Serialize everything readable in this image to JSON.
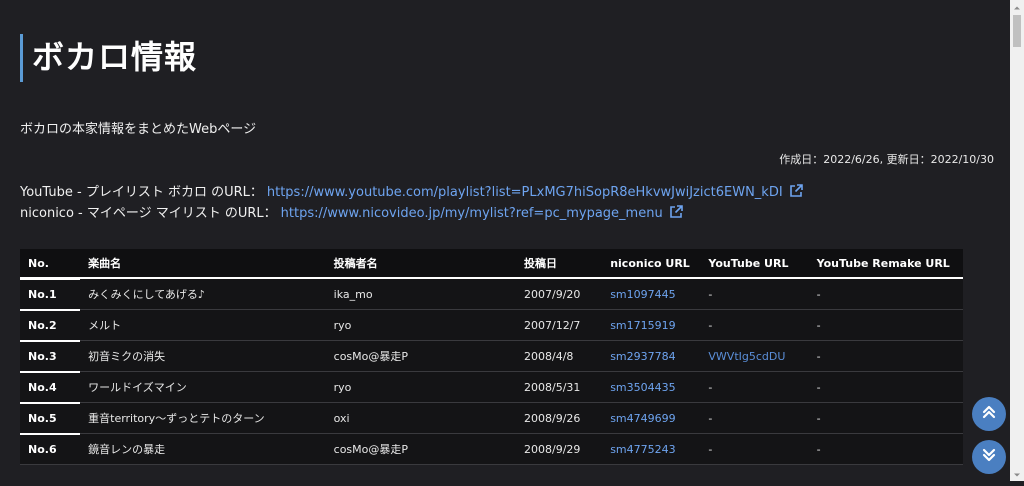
{
  "page": {
    "title": "ボカロ情報",
    "description": "ボカロの本家情報をまとめたWebページ",
    "dates": "作成日：2022/6/26, 更新日：2022/10/30"
  },
  "links": [
    {
      "label": "YouTube - プレイリスト ボカロ のURL：",
      "url": "https://www.youtube.com/playlist?list=PLxMG7hiSopR8eHkvwJwiJzict6EWN_kDI",
      "icon": "external-link-icon"
    },
    {
      "label": "niconico - マイページ マイリスト のURL：",
      "url": "https://www.nicovideo.jp/my/mylist?ref=pc_mypage_menu",
      "icon": "external-link-icon"
    }
  ],
  "table": {
    "headers": [
      "No.",
      "楽曲名",
      "投稿者名",
      "投稿日",
      "niconico URL",
      "YouTube URL",
      "YouTube Remake URL"
    ],
    "rows": [
      {
        "no": "No.1",
        "title": "みくみくにしてあげる♪",
        "author": "ika_mo",
        "date": "2007/9/20",
        "nico": "sm1097445",
        "youtube": "-",
        "remake": "-"
      },
      {
        "no": "No.2",
        "title": "メルト",
        "author": "ryo",
        "date": "2007/12/7",
        "nico": "sm1715919",
        "youtube": "-",
        "remake": "-"
      },
      {
        "no": "No.3",
        "title": "初音ミクの消失",
        "author": "cosMo@暴走P",
        "date": "2008/4/8",
        "nico": "sm2937784",
        "youtube": "VWVtIg5cdDU",
        "remake": "-"
      },
      {
        "no": "No.4",
        "title": "ワールドイズマイン",
        "author": "ryo",
        "date": "2008/5/31",
        "nico": "sm3504435",
        "youtube": "-",
        "remake": "-"
      },
      {
        "no": "No.5",
        "title": "重音territory～ずっとテトのターン",
        "author": "oxi",
        "date": "2008/9/26",
        "nico": "sm4749699",
        "youtube": "-",
        "remake": "-"
      },
      {
        "no": "No.6",
        "title": "鏡音レンの暴走",
        "author": "cosMo@暴走P",
        "date": "2008/9/29",
        "nico": "sm4775243",
        "youtube": "-",
        "remake": "-"
      }
    ]
  },
  "buttons": {
    "scroll_top_icon": "double-chevron-up-icon",
    "scroll_bottom_icon": "double-chevron-down-icon"
  },
  "colors": {
    "background": "#1f1f23",
    "accent": "#5b9bd5",
    "link": "#6ea4f0",
    "fab": "#4a7fc1"
  }
}
